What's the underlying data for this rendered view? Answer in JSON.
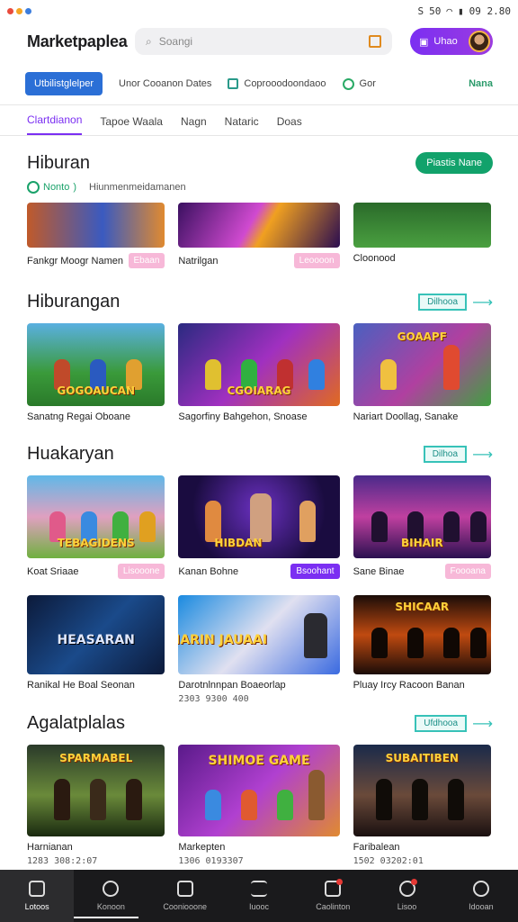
{
  "status": {
    "icons": [
      "S",
      "50"
    ],
    "time": "09 2.80"
  },
  "app": {
    "title": "Marketpaplea",
    "search_placeholder": "Soangi",
    "profile_label": "Uhao"
  },
  "filters": {
    "primary": "Utbilistglelper",
    "items": [
      "Unor Cooanon Dates",
      "Coprooodoondaoo",
      "Gor"
    ],
    "right": "Nana"
  },
  "tabs": [
    "Clartdianon",
    "Tapoe Waala",
    "Nagn",
    "Nataric",
    "Doas"
  ],
  "header": {
    "title": "Hiburan",
    "action": "Piastis Nane",
    "back_label": "Nonto",
    "back_chevron": ")",
    "subtext": "Hiunmenmeidamanen"
  },
  "sections": [
    {
      "title": "",
      "cards": [
        {
          "name": "Fankgr Moogr Namen",
          "tag": "Ebaan",
          "tag_style": "pink",
          "sub": ""
        },
        {
          "name": "Natrilgan",
          "tag": "Leoooon",
          "tag_style": "pink",
          "sub": ""
        },
        {
          "name": "Cloonood",
          "tag": "",
          "tag_style": "",
          "sub": ""
        }
      ]
    },
    {
      "title": "Hiburangan",
      "see_all": "Dilhooa",
      "cards": [
        {
          "name": "Sanatng Regai Oboane",
          "tag": "",
          "tag_style": "",
          "sub": "",
          "banner": "GOGOAUCAN"
        },
        {
          "name": "Sagorfiny Bahgehon, Snoase",
          "tag": "",
          "tag_style": "",
          "sub": "",
          "banner": "CGOIARAG"
        },
        {
          "name": "Nariart Doollag, Sanake",
          "tag": "",
          "tag_style": "",
          "sub": "",
          "banner": "GOAAPF"
        }
      ]
    },
    {
      "title": "Huakaryan",
      "see_all": "Dilhoa",
      "cards": [
        {
          "name": "Koat Sriaae",
          "tag": "Lisooone",
          "tag_style": "pink",
          "sub": "",
          "banner": "TEBAGIDENS"
        },
        {
          "name": "Kanan Bohne",
          "tag": "Bsoohant",
          "tag_style": "purple",
          "sub": "",
          "banner": "HIBDAN"
        },
        {
          "name": "Sane Binae",
          "tag": "Foooana",
          "tag_style": "pink",
          "sub": "",
          "banner": "BIHAIR"
        }
      ]
    },
    {
      "title": "",
      "cards": [
        {
          "name": "Ranikal He Boal Seonan",
          "tag": "",
          "tag_style": "",
          "sub": "",
          "banner": "HEASARAN"
        },
        {
          "name": "Darotnlnnpan Boaeorlap",
          "tag": "",
          "tag_style": "",
          "sub": "2303 9300 400",
          "banner": "JIARIN JAUAAI"
        },
        {
          "name": "Pluay Ircy Racoon Banan",
          "tag": "",
          "tag_style": "",
          "sub": "",
          "banner": "SHICAAR"
        }
      ]
    },
    {
      "title": "Agalatplalas",
      "see_all": "Ufdhooa",
      "cards": [
        {
          "name": "Harnianan",
          "tag": "",
          "tag_style": "",
          "sub": "1283 308:2:07",
          "banner": "SPARMABEL"
        },
        {
          "name": "Markepten",
          "tag": "",
          "tag_style": "",
          "sub": "1306 0193307",
          "banner": "SHIMOE GAME"
        },
        {
          "name": "Faribalean",
          "tag": "",
          "tag_style": "",
          "sub": "1502 03202:01",
          "banner": "SUBAITIBEN"
        }
      ]
    }
  ],
  "nav": [
    "Lotoos",
    "Konoon",
    "Cooniooone",
    "Iuooc",
    "Caolinton",
    "Lisoo",
    "Idooan"
  ],
  "colors": {
    "accent": "#7b2ff2",
    "primary_blue": "#2b6fd6",
    "green": "#12a26b",
    "teal": "#37c2b8"
  }
}
